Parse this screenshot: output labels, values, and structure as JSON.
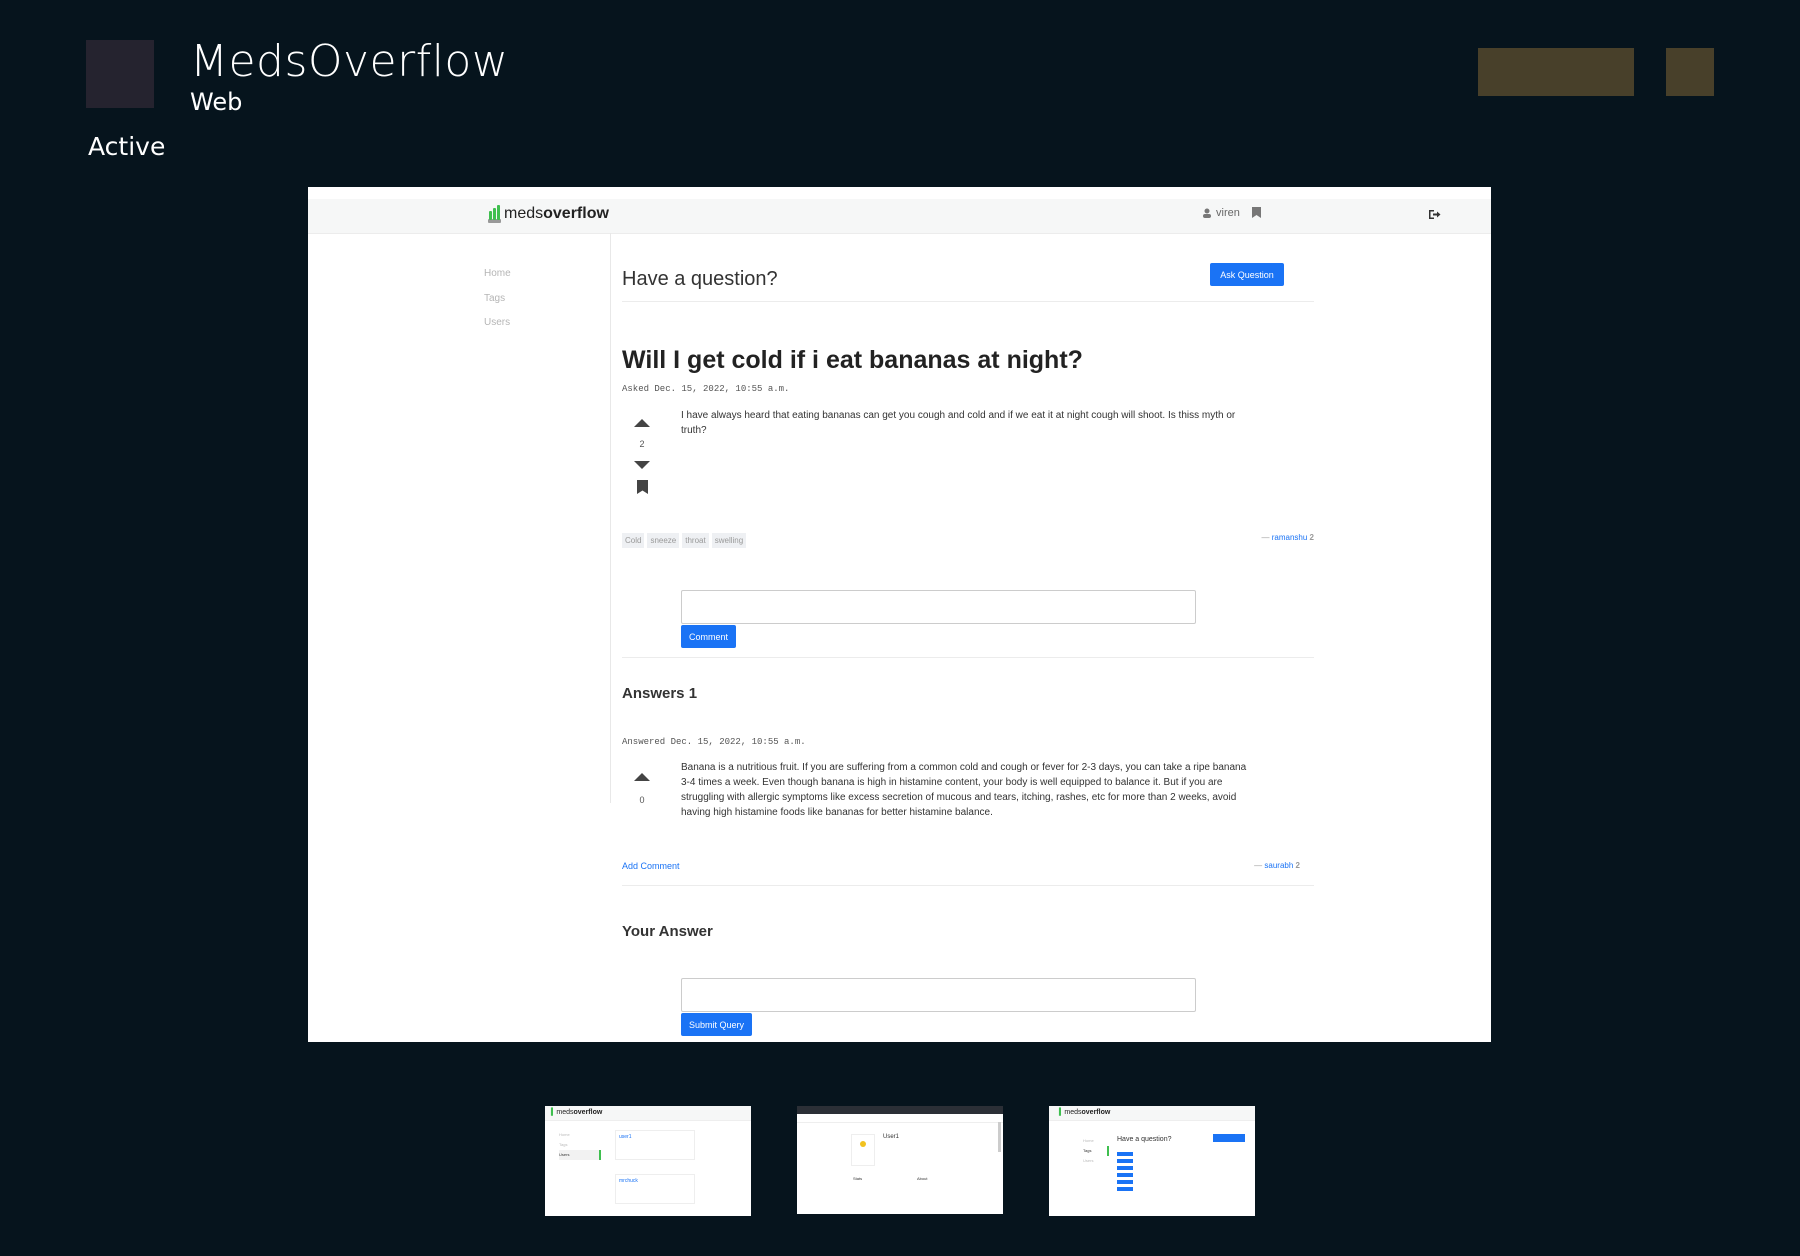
{
  "header": {
    "app_title": "MedsOverflow",
    "app_subtitle": "Web",
    "status": "Active"
  },
  "nav": {
    "logo_prefix": "meds",
    "logo_bold": "overflow",
    "username": "viren"
  },
  "sidebar": {
    "items": [
      {
        "label": "Home"
      },
      {
        "label": "Tags"
      },
      {
        "label": "Users"
      }
    ]
  },
  "main": {
    "heading": "Have a question?",
    "ask_button": "Ask Question",
    "question": {
      "title": "Will I get cold if i eat bananas at night?",
      "asked": "Asked Dec. 15, 2022, 10:55 a.m.",
      "body": "I have always heard that eating bananas can get you cough and cold and if we eat it at night cough will shoot. Is thiss myth or truth?",
      "votes": "2",
      "tags": [
        "Cold",
        "sneeze",
        "throat",
        "swelling"
      ],
      "author_dash": "—",
      "author": "ramanshu",
      "author_rep": "2"
    },
    "comment_button": "Comment",
    "comment_placeholder": "",
    "answers_heading": "Answers 1",
    "answers": [
      {
        "answered": "Answered Dec. 15, 2022, 10:55 a.m.",
        "body": "Banana is a nutritious fruit. If you are suffering from a common cold and cough or fever for 2-3 days, you can take a ripe banana 3-4 times a week. Even though banana is high in histamine content, your body is well equipped to balance it. But if you are struggling with allergic symptoms like excess secretion of mucous and tears, itching, rashes, etc for more than 2 weeks, avoid having high histamine foods like bananas for better histamine balance.",
        "votes": "0",
        "add_comment": "Add Comment",
        "author_dash": "—",
        "author": "saurabh",
        "author_rep": "2"
      }
    ],
    "your_answer_heading": "Your Answer",
    "answer_placeholder": "",
    "submit_button": "Submit Query"
  },
  "thumbnails": [
    {
      "label": "Users page"
    },
    {
      "label": "User profile page"
    },
    {
      "label": "Tags page"
    }
  ]
}
